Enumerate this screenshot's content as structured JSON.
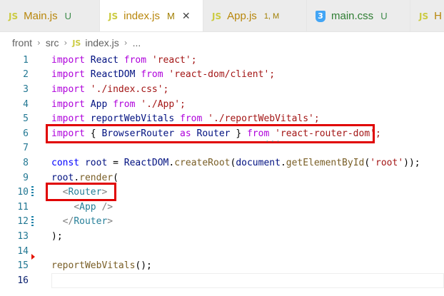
{
  "tabs": [
    {
      "label": "Main.js",
      "icon": "JS",
      "status": "U",
      "active": false
    },
    {
      "label": "index.js",
      "icon": "JS",
      "status": "M",
      "active": true
    },
    {
      "label": "App.js",
      "icon": "JS",
      "status": "1, M",
      "active": false
    },
    {
      "label": "main.css",
      "icon": "css",
      "status": "U",
      "active": false
    },
    {
      "label": "H",
      "icon": "JS",
      "status": "",
      "active": false
    }
  ],
  "breadcrumb": {
    "items": [
      "front",
      "src",
      "index.js",
      "..."
    ],
    "js_badge": "JS"
  },
  "close_glyph": "✕",
  "editor": {
    "current_line": 16,
    "lines": [
      {
        "n": "1"
      },
      {
        "n": "2"
      },
      {
        "n": "3"
      },
      {
        "n": "4"
      },
      {
        "n": "5"
      },
      {
        "n": "6"
      },
      {
        "n": "7"
      },
      {
        "n": "8"
      },
      {
        "n": "9"
      },
      {
        "n": "10"
      },
      {
        "n": "11"
      },
      {
        "n": "12"
      },
      {
        "n": "13"
      },
      {
        "n": "14"
      },
      {
        "n": "15"
      },
      {
        "n": "16"
      }
    ],
    "code": {
      "l1": [
        "import",
        "React",
        "from",
        "'react';"
      ],
      "l2": [
        "import",
        "ReactDOM",
        "from",
        "'react-dom/client';"
      ],
      "l3": [
        "import",
        "'./index.css';"
      ],
      "l4": [
        "import",
        "App",
        "from",
        "'./App';"
      ],
      "l5": [
        "import",
        "reportWebVitals",
        "from",
        "'./reportWebVitals';"
      ],
      "l6": [
        "import",
        "{",
        "BrowserRouter",
        "as",
        "Router",
        "}",
        "from",
        "'react-router-dom';"
      ],
      "l8": [
        "const",
        "root",
        "=",
        "ReactDOM",
        ".",
        "createRoot",
        "(",
        "document",
        ".",
        "getElementById",
        "(",
        "'root'",
        "));"
      ],
      "l9": [
        "root",
        ".",
        "render",
        "("
      ],
      "l10": [
        "<",
        "Router",
        ">"
      ],
      "l11": [
        "<",
        "App",
        "/>"
      ],
      "l12": [
        "</",
        "Router",
        ">"
      ],
      "l13": [
        ");"
      ],
      "l15": [
        "reportWebVitals",
        "();"
      ]
    },
    "dots": "..."
  },
  "colors": {
    "keyword": "#af00db",
    "string": "#a31515",
    "highlight_box": "#e00000",
    "line_number": "#237893"
  }
}
